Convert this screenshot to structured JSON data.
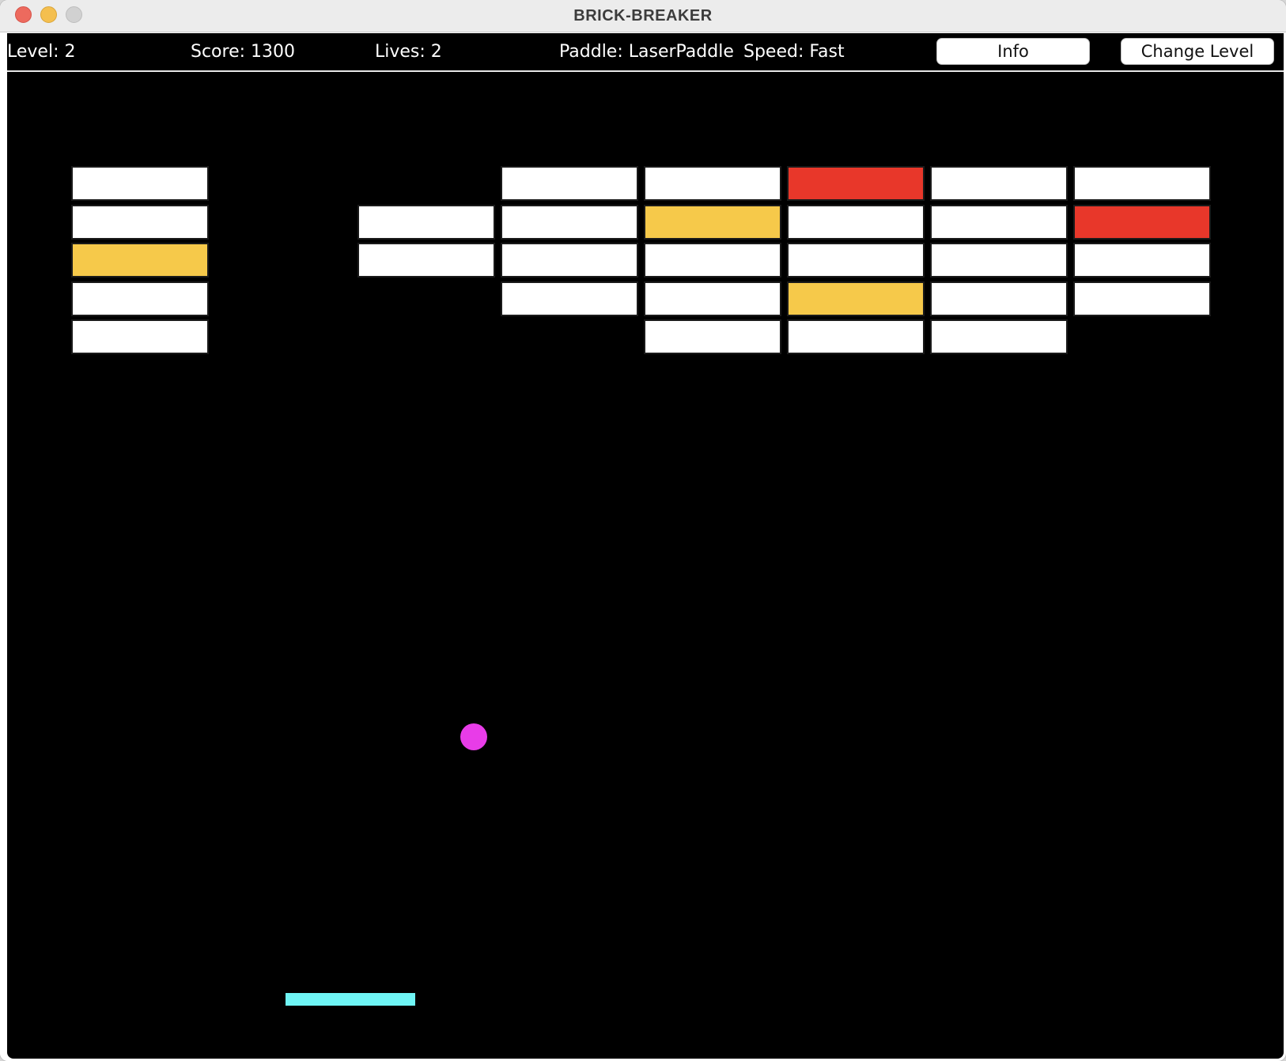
{
  "window": {
    "title": "BRICK-BREAKER"
  },
  "hud": {
    "level": "Level: 2",
    "score": "Score: 1300",
    "lives": "Lives: 2",
    "paddle": "Paddle: LaserPaddle",
    "speed": "Speed: Fast",
    "info_button": "Info",
    "change_level_button": "Change Level"
  },
  "colors": {
    "background": "#000000",
    "brick_normal": "#ffffff",
    "brick_yellow": "#f6c94a",
    "brick_red": "#e8372a",
    "ball": "#e83ce8",
    "paddle": "#6ff5f5"
  },
  "bricks": [
    {
      "col": 0,
      "row": 0,
      "type": "normal"
    },
    {
      "col": 0,
      "row": 1,
      "type": "normal"
    },
    {
      "col": 0,
      "row": 2,
      "type": "yellow"
    },
    {
      "col": 0,
      "row": 3,
      "type": "normal"
    },
    {
      "col": 0,
      "row": 4,
      "type": "normal"
    },
    {
      "col": 2,
      "row": 1,
      "type": "normal"
    },
    {
      "col": 2,
      "row": 2,
      "type": "normal"
    },
    {
      "col": 3,
      "row": 0,
      "type": "normal"
    },
    {
      "col": 3,
      "row": 1,
      "type": "normal"
    },
    {
      "col": 3,
      "row": 2,
      "type": "normal"
    },
    {
      "col": 3,
      "row": 3,
      "type": "normal"
    },
    {
      "col": 4,
      "row": 0,
      "type": "normal"
    },
    {
      "col": 4,
      "row": 1,
      "type": "yellow"
    },
    {
      "col": 4,
      "row": 2,
      "type": "normal"
    },
    {
      "col": 4,
      "row": 3,
      "type": "normal"
    },
    {
      "col": 4,
      "row": 4,
      "type": "normal"
    },
    {
      "col": 5,
      "row": 0,
      "type": "red"
    },
    {
      "col": 5,
      "row": 1,
      "type": "normal"
    },
    {
      "col": 5,
      "row": 2,
      "type": "normal"
    },
    {
      "col": 5,
      "row": 3,
      "type": "yellow"
    },
    {
      "col": 5,
      "row": 4,
      "type": "normal"
    },
    {
      "col": 6,
      "row": 0,
      "type": "normal"
    },
    {
      "col": 6,
      "row": 1,
      "type": "normal"
    },
    {
      "col": 6,
      "row": 2,
      "type": "normal"
    },
    {
      "col": 6,
      "row": 3,
      "type": "normal"
    },
    {
      "col": 6,
      "row": 4,
      "type": "normal"
    },
    {
      "col": 7,
      "row": 0,
      "type": "normal"
    },
    {
      "col": 7,
      "row": 1,
      "type": "red"
    },
    {
      "col": 7,
      "row": 2,
      "type": "normal"
    },
    {
      "col": 7,
      "row": 3,
      "type": "normal"
    }
  ]
}
